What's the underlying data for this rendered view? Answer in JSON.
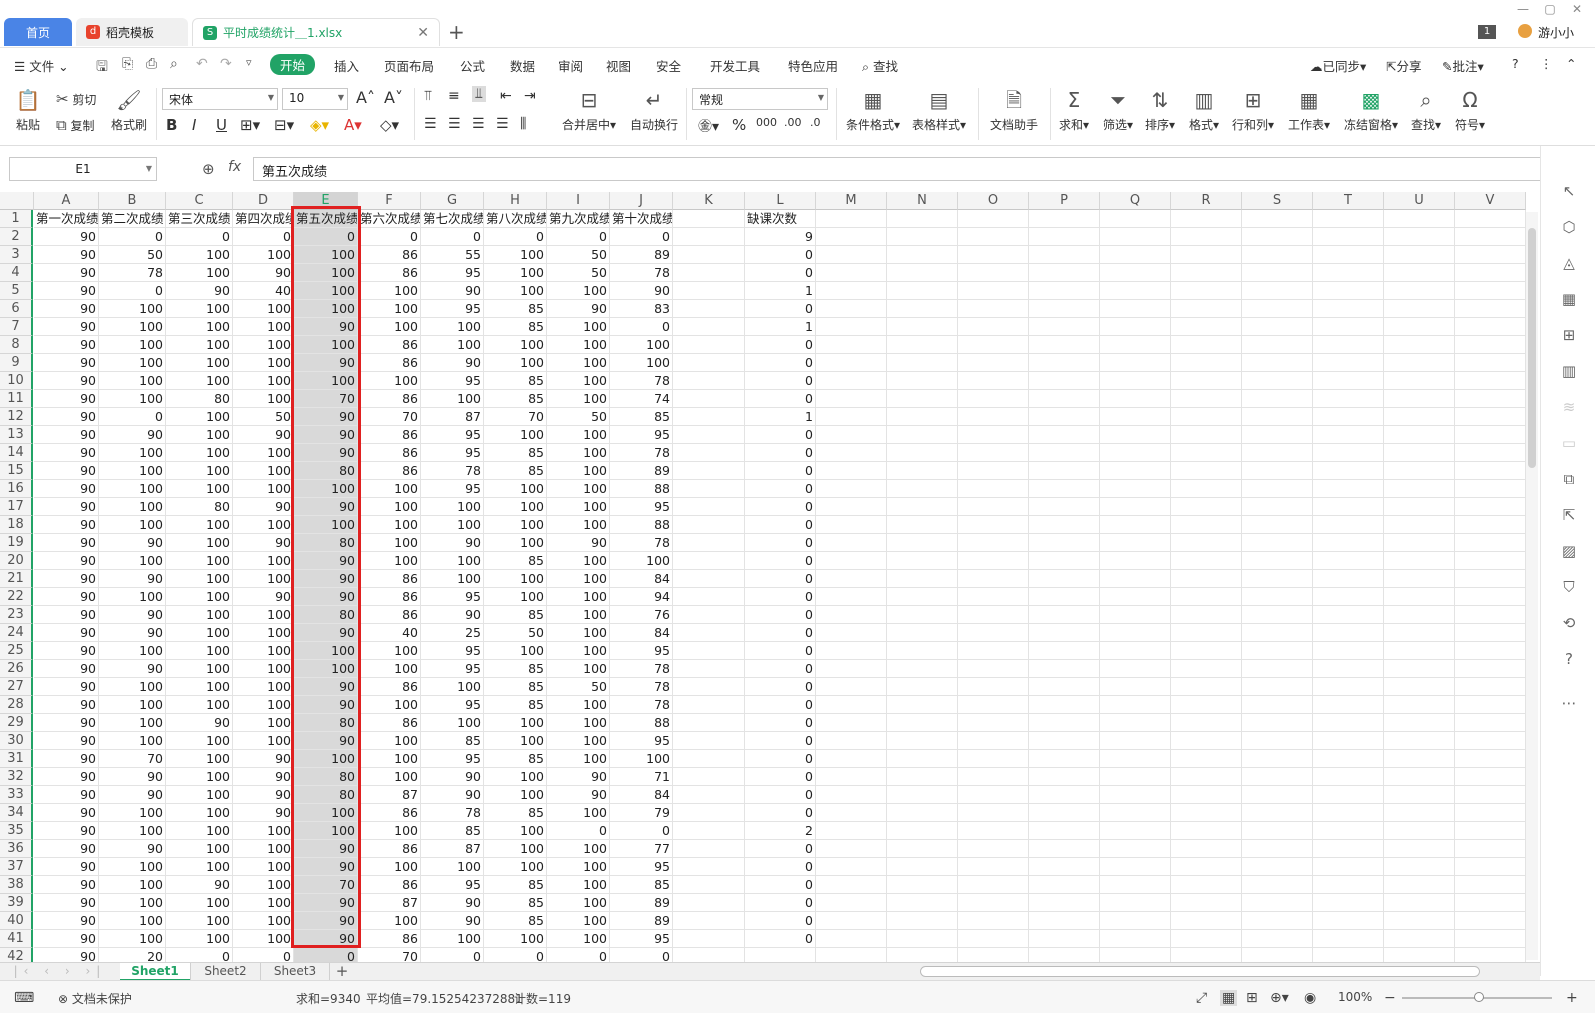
{
  "tabs": {
    "home": "首页",
    "template": "稻壳模板",
    "file": "平时成绩统计＿1.xlsx",
    "add": "+"
  },
  "user": {
    "name": "游小小",
    "badge": "1"
  },
  "menu": {
    "file": "文件",
    "items": [
      "开始",
      "插入",
      "页面布局",
      "公式",
      "数据",
      "审阅",
      "视图",
      "安全",
      "开发工具",
      "特色应用"
    ],
    "search": "查找",
    "sync": "已同步",
    "share": "分享",
    "comment": "批注"
  },
  "ribbon": {
    "paste": "粘贴",
    "cut": "剪切",
    "copy": "复制",
    "format_painter": "格式刷",
    "font": "宋体",
    "font_size": "10",
    "merge": "合并居中",
    "wrap": "自动换行",
    "number_format": "常规",
    "cond_format": "条件格式",
    "table_style": "表格样式",
    "doc_helper": "文档助手",
    "sum": "求和",
    "filter": "筛选",
    "sort": "排序",
    "format": "格式",
    "rowcol": "行和列",
    "worksheet": "工作表",
    "freeze": "冻结窗格",
    "find": "查找",
    "symbol": "符号"
  },
  "formula": {
    "cell_ref": "E1",
    "fx": "fx",
    "content": "第五次成绩"
  },
  "columns": [
    "A",
    "B",
    "C",
    "D",
    "E",
    "F",
    "G",
    "H",
    "I",
    "J",
    "K",
    "L",
    "M",
    "N",
    "O",
    "P",
    "Q",
    "R",
    "S",
    "T",
    "U",
    "V"
  ],
  "header_row": [
    "第一次成绩",
    "第二次成绩",
    "第三次成绩",
    "第四次成绩",
    "第五次成绩",
    "第六次成绩",
    "第七次成绩",
    "第八次成绩",
    "第九次成绩",
    "第十次成绩",
    "",
    "缺课次数"
  ],
  "rows": [
    [
      90,
      0,
      0,
      0,
      0,
      0,
      0,
      0,
      0,
      0,
      "",
      9
    ],
    [
      90,
      50,
      100,
      100,
      100,
      86,
      55,
      100,
      50,
      89,
      "",
      0
    ],
    [
      90,
      78,
      100,
      90,
      100,
      86,
      95,
      100,
      50,
      78,
      "",
      0
    ],
    [
      90,
      0,
      90,
      40,
      100,
      100,
      90,
      100,
      100,
      90,
      "",
      1
    ],
    [
      90,
      100,
      100,
      100,
      100,
      100,
      95,
      85,
      90,
      83,
      "",
      0
    ],
    [
      90,
      100,
      100,
      100,
      90,
      100,
      100,
      85,
      100,
      0,
      "",
      1
    ],
    [
      90,
      100,
      100,
      100,
      100,
      86,
      100,
      100,
      100,
      100,
      "",
      0
    ],
    [
      90,
      100,
      100,
      100,
      90,
      86,
      90,
      100,
      100,
      100,
      "",
      0
    ],
    [
      90,
      100,
      100,
      100,
      100,
      100,
      95,
      85,
      100,
      78,
      "",
      0
    ],
    [
      90,
      100,
      80,
      100,
      70,
      86,
      100,
      85,
      100,
      74,
      "",
      0
    ],
    [
      90,
      0,
      100,
      50,
      90,
      70,
      87,
      70,
      50,
      85,
      "",
      1
    ],
    [
      90,
      90,
      100,
      90,
      90,
      86,
      95,
      100,
      100,
      95,
      "",
      0
    ],
    [
      90,
      100,
      100,
      100,
      90,
      86,
      95,
      85,
      100,
      78,
      "",
      0
    ],
    [
      90,
      100,
      100,
      100,
      80,
      86,
      78,
      85,
      100,
      89,
      "",
      0
    ],
    [
      90,
      100,
      100,
      100,
      100,
      100,
      95,
      100,
      100,
      88,
      "",
      0
    ],
    [
      90,
      100,
      80,
      90,
      90,
      100,
      100,
      100,
      100,
      95,
      "",
      0
    ],
    [
      90,
      100,
      100,
      100,
      100,
      100,
      100,
      100,
      100,
      88,
      "",
      0
    ],
    [
      90,
      90,
      100,
      90,
      80,
      100,
      90,
      100,
      90,
      78,
      "",
      0
    ],
    [
      90,
      100,
      100,
      100,
      90,
      100,
      100,
      85,
      100,
      100,
      "",
      0
    ],
    [
      90,
      90,
      100,
      100,
      90,
      86,
      100,
      100,
      100,
      84,
      "",
      0
    ],
    [
      90,
      100,
      100,
      90,
      90,
      86,
      95,
      100,
      100,
      94,
      "",
      0
    ],
    [
      90,
      90,
      100,
      100,
      80,
      86,
      90,
      85,
      100,
      76,
      "",
      0
    ],
    [
      90,
      90,
      100,
      100,
      90,
      40,
      25,
      50,
      100,
      84,
      "",
      0
    ],
    [
      90,
      100,
      100,
      100,
      100,
      100,
      95,
      100,
      100,
      95,
      "",
      0
    ],
    [
      90,
      90,
      100,
      100,
      100,
      100,
      95,
      85,
      100,
      78,
      "",
      0
    ],
    [
      90,
      100,
      100,
      100,
      90,
      86,
      100,
      85,
      50,
      78,
      "",
      0
    ],
    [
      90,
      100,
      100,
      100,
      90,
      100,
      95,
      85,
      100,
      78,
      "",
      0
    ],
    [
      90,
      100,
      90,
      100,
      80,
      86,
      100,
      100,
      100,
      88,
      "",
      0
    ],
    [
      90,
      100,
      100,
      100,
      90,
      100,
      85,
      100,
      100,
      95,
      "",
      0
    ],
    [
      90,
      70,
      100,
      90,
      100,
      100,
      95,
      85,
      100,
      100,
      "",
      0
    ],
    [
      90,
      90,
      100,
      90,
      80,
      100,
      90,
      100,
      90,
      71,
      "",
      0
    ],
    [
      90,
      90,
      100,
      90,
      80,
      87,
      90,
      100,
      90,
      84,
      "",
      0
    ],
    [
      90,
      100,
      100,
      90,
      100,
      86,
      78,
      85,
      100,
      79,
      "",
      0
    ],
    [
      90,
      100,
      100,
      100,
      100,
      100,
      85,
      100,
      0,
      0,
      "",
      2
    ],
    [
      90,
      90,
      100,
      100,
      90,
      86,
      87,
      100,
      100,
      77,
      "",
      0
    ],
    [
      90,
      100,
      100,
      100,
      90,
      100,
      100,
      100,
      100,
      95,
      "",
      0
    ],
    [
      90,
      100,
      90,
      100,
      70,
      86,
      95,
      85,
      100,
      85,
      "",
      0
    ],
    [
      90,
      100,
      100,
      100,
      90,
      87,
      90,
      85,
      100,
      89,
      "",
      0
    ],
    [
      90,
      100,
      100,
      100,
      90,
      100,
      90,
      85,
      100,
      89,
      "",
      0
    ],
    [
      90,
      100,
      100,
      100,
      90,
      86,
      100,
      100,
      100,
      95,
      "",
      0
    ],
    [
      90,
      20,
      0,
      0,
      0,
      70,
      0,
      0,
      0,
      0,
      "",
      ""
    ]
  ],
  "sheets": [
    "Sheet1",
    "Sheet2",
    "Sheet3"
  ],
  "status": {
    "protect": "文档未保护",
    "sum": "求和=9340",
    "avg": "平均值=79.152542372881",
    "count": "计数=119",
    "zoom": "100%"
  },
  "colors": {
    "accent": "#21a366",
    "selection": "#e02020",
    "home_tab": "#4a84e6"
  }
}
